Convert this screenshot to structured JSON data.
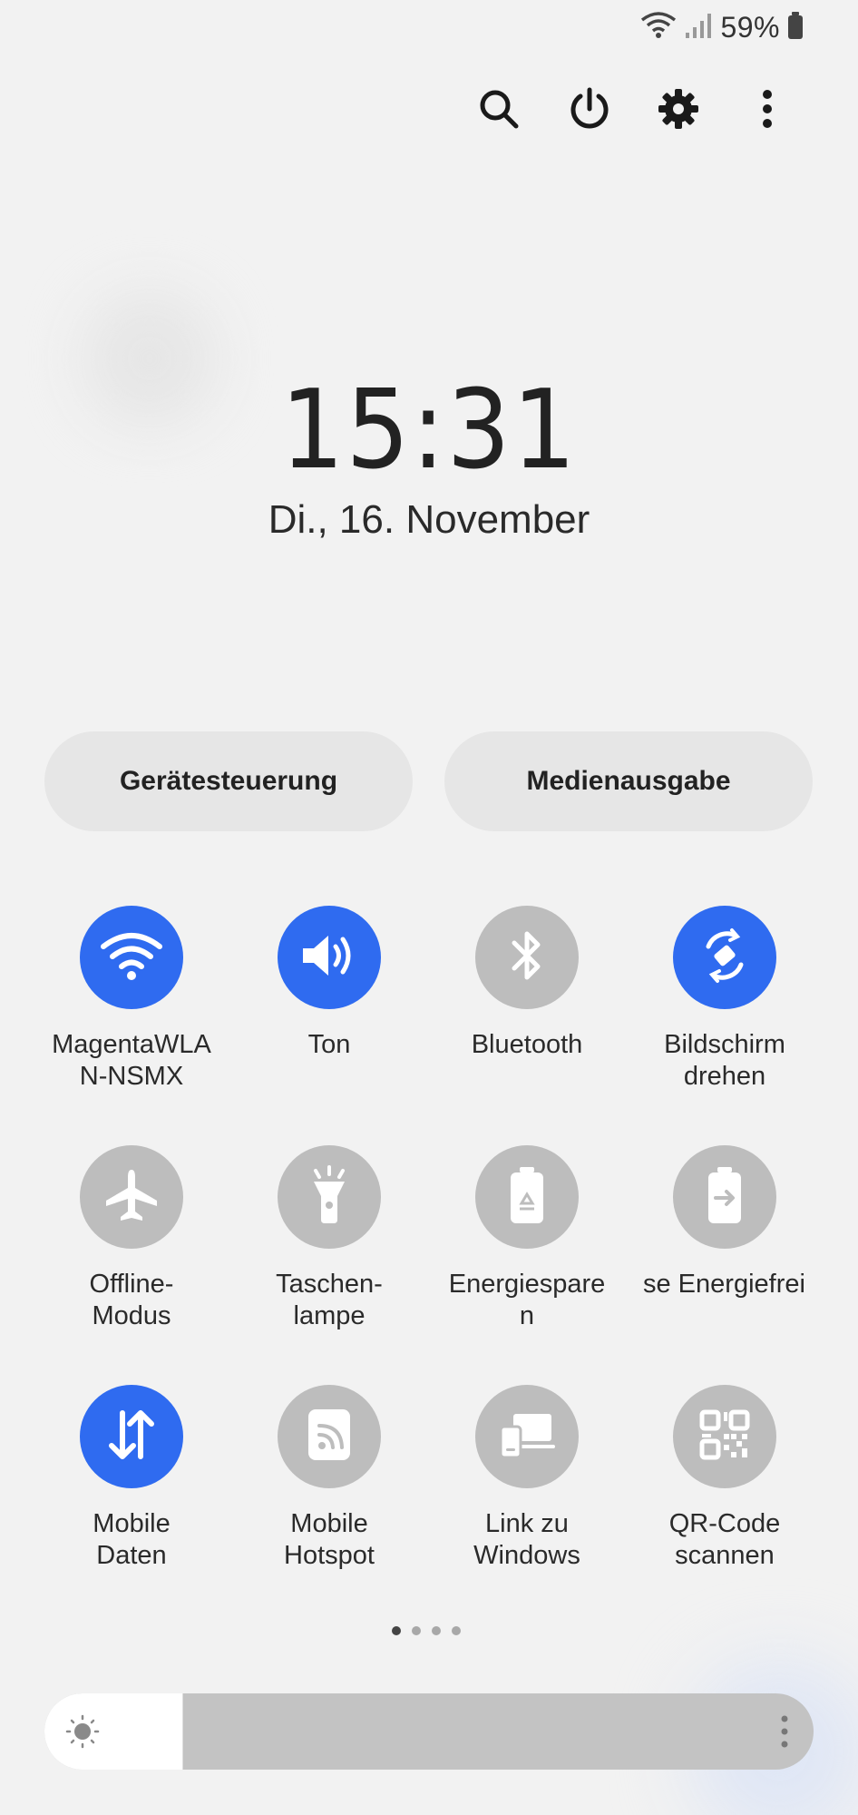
{
  "status_bar": {
    "battery_text": "59%",
    "icons": [
      "wifi-icon",
      "signal-icon",
      "battery-icon"
    ]
  },
  "top_actions": [
    "search-icon",
    "power-icon",
    "settings-gear-icon",
    "more-vert-icon"
  ],
  "clock": {
    "time": "15:31",
    "date": "Di., 16. November"
  },
  "pills": {
    "device_control": "Gerätesteuerung",
    "media_output": "Medienausgabe"
  },
  "tiles": [
    {
      "label": "MagentaWLA\nN-NSMX",
      "icon": "wifi-icon",
      "on": true
    },
    {
      "label": "Ton",
      "icon": "speaker-icon",
      "on": true
    },
    {
      "label": "Bluetooth",
      "icon": "bluetooth-icon",
      "on": false
    },
    {
      "label": "Bildschirm\ndrehen",
      "icon": "rotate-icon",
      "on": true
    },
    {
      "label": "Offline-\nModus",
      "icon": "airplane-icon",
      "on": false
    },
    {
      "label": "Taschen-\nlampe",
      "icon": "flashlight-icon",
      "on": false
    },
    {
      "label": "Energiespare\nn",
      "icon": "battery-saver-icon",
      "on": false
    },
    {
      "label": "se Energiefreig",
      "icon": "battery-share-icon",
      "on": false
    },
    {
      "label": "Mobile\nDaten",
      "icon": "mobile-data-icon",
      "on": true
    },
    {
      "label": "Mobile\nHotspot",
      "icon": "hotspot-icon",
      "on": false
    },
    {
      "label": "Link zu\nWindows",
      "icon": "link-windows-icon",
      "on": false
    },
    {
      "label": "QR-Code\nscannen",
      "icon": "qr-code-icon",
      "on": false
    }
  ],
  "pager": {
    "pages": 4,
    "current": 1
  },
  "brightness": {
    "level": 0.18,
    "icon": "sun-icon"
  },
  "colors": {
    "accent": "#2f6bf0",
    "tile_off": "#bdbdbd",
    "background": "#f2f2f2"
  }
}
